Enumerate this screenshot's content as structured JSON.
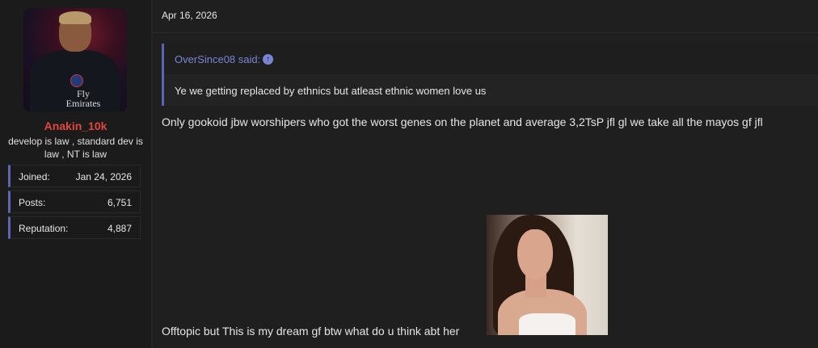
{
  "user": {
    "username": "Anakin_10k",
    "title": "develop is law , standard dev is law , NT is law",
    "avatar_text": "Fly Emirates",
    "stats": [
      {
        "label": "Joined:",
        "value": "Jan 24, 2026"
      },
      {
        "label": "Posts:",
        "value": "6,751"
      },
      {
        "label": "Reputation:",
        "value": "4,887"
      }
    ]
  },
  "post": {
    "date": "Apr 16, 2026",
    "quote": {
      "author": "OverSince08 said:",
      "text": "Ye we getting replaced by ethnics but atleast ethnic women love us"
    },
    "body": "Only gookoid jbw worshipers who got the worst genes on the planet and average 3,2TsP jfl gl we take all the mayos gf jfl",
    "offtopic": "Offtopic but This is my dream gf btw what do u think abt her"
  },
  "colors": {
    "username": "#e2453f",
    "accent": "#5d64b3",
    "quote_author": "#7a84d6",
    "background": "#1f1f1f"
  },
  "icons": [
    "arrow-up-circle-icon"
  ]
}
